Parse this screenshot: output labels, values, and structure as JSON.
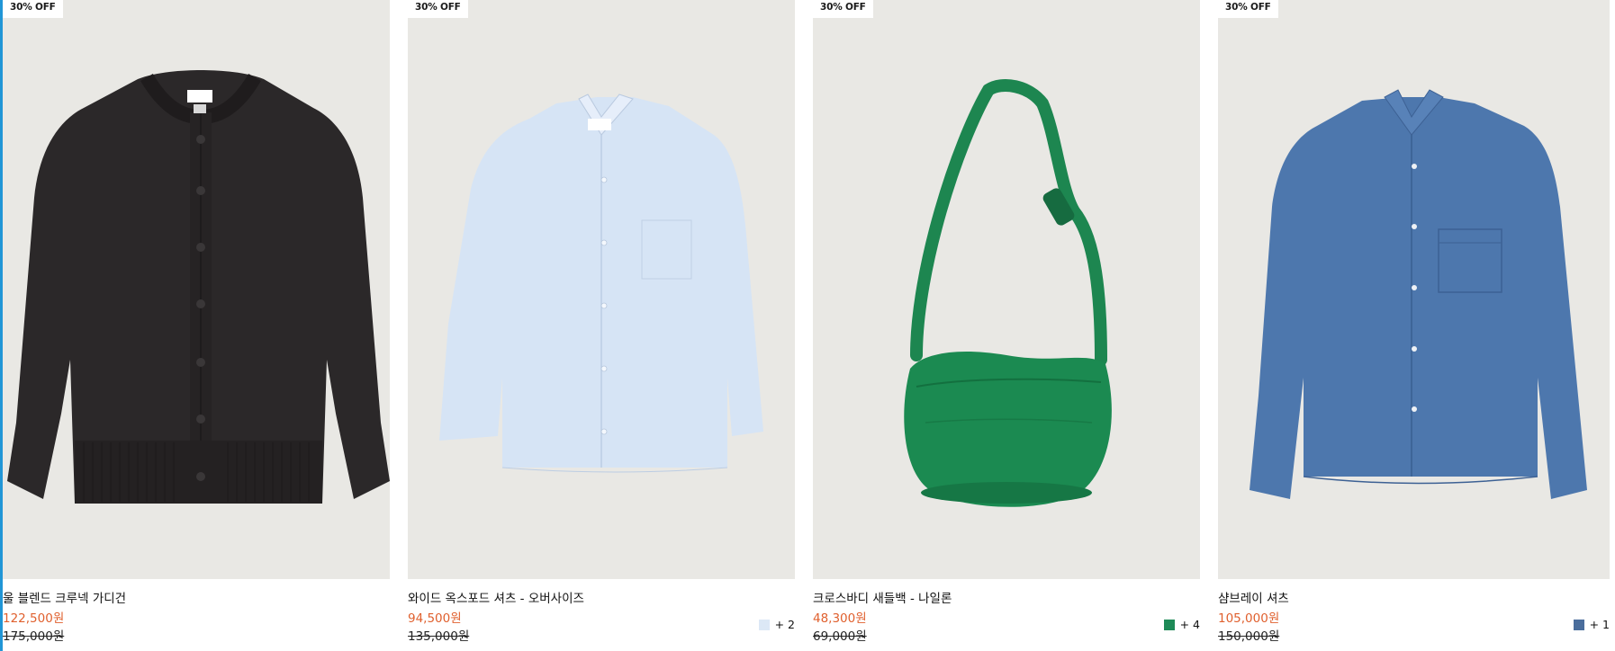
{
  "products": [
    {
      "badge": "30% OFF",
      "name": "울 블렌드 크루넥 가디건",
      "sale_price": "122,500원",
      "original_price": "175,000원",
      "swatch_color": "",
      "more_colors": ""
    },
    {
      "badge": "30% OFF",
      "name": "와이드 옥스포드 셔츠 - 오버사이즈",
      "sale_price": "94,500원",
      "original_price": "135,000원",
      "swatch_color": "#dce8f6",
      "more_colors": "+ 2"
    },
    {
      "badge": "30% OFF",
      "name": "크로스바디 새들백 - 나일론",
      "sale_price": "48,300원",
      "original_price": "69,000원",
      "swatch_color": "#1e8a57",
      "more_colors": "+ 4"
    },
    {
      "badge": "30% OFF",
      "name": "샴브레이 셔츠",
      "sale_price": "105,000원",
      "original_price": "150,000원",
      "swatch_color": "#4a6d9c",
      "more_colors": "+ 1"
    }
  ],
  "colors": {
    "sale_price": "#e0602e",
    "image_background": "#e9e8e4",
    "left_accent": "#2196d6"
  }
}
